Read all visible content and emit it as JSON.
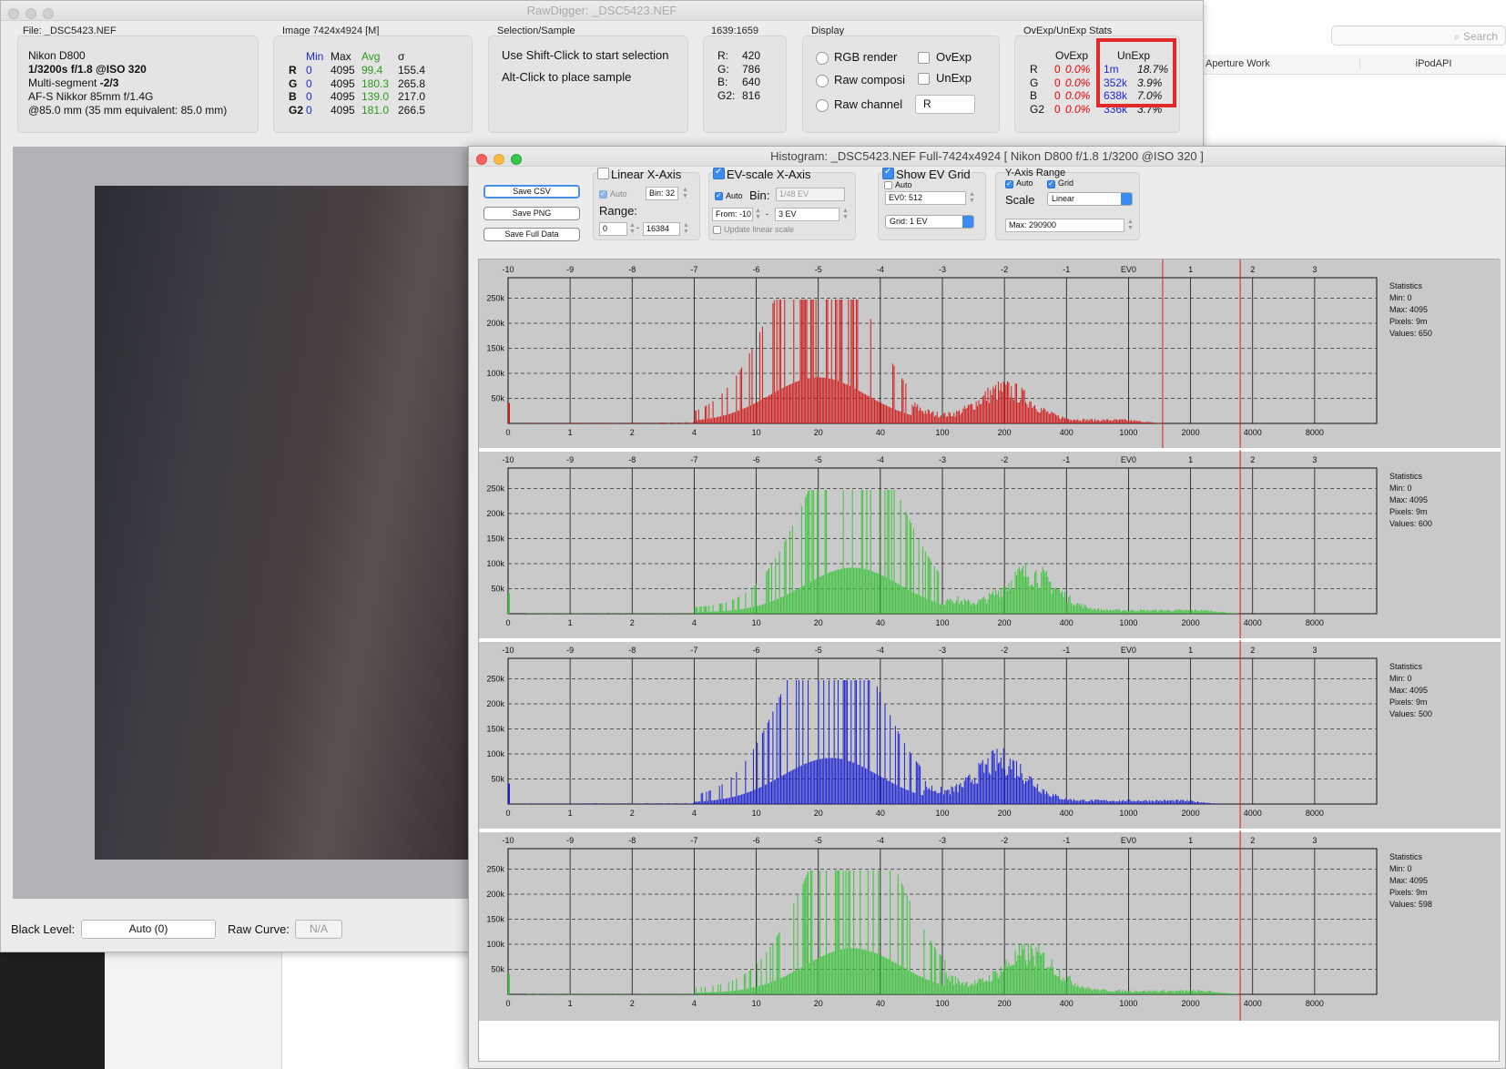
{
  "main_window": {
    "title": "RawDigger: _DSC5423.NEF",
    "file": {
      "title": "File: _DSC5423.NEF",
      "camera": "Nikon D800",
      "exposure": "1/3200s f/1.8 @ISO 320",
      "metering_prefix": "Multi-segment ",
      "metering_value": "-2/3",
      "lens": "AF-S Nikkor 85mm f/1.4G",
      "focal": "@85.0 mm (35 mm equivalent: 85.0 mm)"
    },
    "image": {
      "title": "Image 7424x4924 [M]",
      "headers": [
        "Min",
        "Max",
        "Avg",
        "σ"
      ],
      "rows": [
        {
          "ch": "R",
          "min": "0",
          "max": "4095",
          "avg": "99.4",
          "sigma": "155.4"
        },
        {
          "ch": "G",
          "min": "0",
          "max": "4095",
          "avg": "180.3",
          "sigma": "265.8"
        },
        {
          "ch": "B",
          "min": "0",
          "max": "4095",
          "avg": "139.0",
          "sigma": "217.0"
        },
        {
          "ch": "G2",
          "min": "0",
          "max": "4095",
          "avg": "181.0",
          "sigma": "266.5"
        }
      ]
    },
    "selection": {
      "title": "Selection/Sample",
      "line1": "Use Shift-Click to start selection",
      "line2": "Alt-Click to place sample"
    },
    "sample": {
      "title": "1639:1659",
      "rows": [
        {
          "k": "R:",
          "v": "420"
        },
        {
          "k": "G:",
          "v": "786"
        },
        {
          "k": "B:",
          "v": "640"
        },
        {
          "k": "G2:",
          "v": "816"
        }
      ]
    },
    "display": {
      "title": "Display",
      "rgb": "RGB render",
      "raw_comp": "Raw composi",
      "raw_channel": "Raw channel",
      "ovexp": "OvExp",
      "unexp": "UnExp",
      "channel_value": "R"
    },
    "stats": {
      "title": "OvExp/UnExp Stats",
      "ov_header": "OvExp",
      "un_header": "UnExp",
      "rows": [
        {
          "ch": "R",
          "ov": "0",
          "ovp": "0.0%",
          "un": "1m",
          "unp": "18.7%"
        },
        {
          "ch": "G",
          "ov": "0",
          "ovp": "0.0%",
          "un": "352k",
          "unp": "3.9%"
        },
        {
          "ch": "B",
          "ov": "0",
          "ovp": "0.0%",
          "un": "638k",
          "unp": "7.0%"
        },
        {
          "ch": "G2",
          "ov": "0",
          "ovp": "0.0%",
          "un": "336k",
          "unp": "3.7%"
        }
      ]
    },
    "black_level_label": "Black Level:",
    "black_level_value": "Auto (0)",
    "raw_curve_label": "Raw Curve:",
    "raw_curve_value": "N/A"
  },
  "background": {
    "search_placeholder": "Search",
    "col1": "Aperture Work",
    "col2": "iPodAPI"
  },
  "histogram_window": {
    "title": "Histogram: _DSC5423.NEF Full-7424x4924 [ Nikon D800 f/1.8 1/3200 @ISO 320 ]",
    "buttons": [
      "Save CSV",
      "Save PNG",
      "Save Full Data"
    ],
    "linear": {
      "label": "Linear X-Axis",
      "auto": "Auto",
      "bin": "Bin: 32",
      "range_label": "Range:",
      "range_from": "0",
      "range_to": "16384"
    },
    "ev": {
      "label": "EV-scale X-Axis",
      "auto": "Auto",
      "bin_label": "Bin:",
      "bin": "1/48 EV",
      "from": "From: -10",
      "to": "3 EV",
      "update": "Update linear scale"
    },
    "evgrid": {
      "label": "Show EV Grid",
      "auto": "Auto",
      "ev0": "EV0: 512",
      "grid": "Grid: 1 EV"
    },
    "yaxis": {
      "label": "Y-Axis Range",
      "auto": "Auto",
      "grid": "Grid",
      "scale_label": "Scale",
      "scale": "Linear",
      "max": "Max: 290900"
    },
    "ev_ticks": [
      "-10",
      "-9",
      "-8",
      "-7",
      "-6",
      "-5",
      "-4",
      "-3",
      "-2",
      "-1",
      "EV0",
      "1",
      "2",
      "3"
    ],
    "x_ticks": [
      "0",
      "1",
      "2",
      "4",
      "10",
      "20",
      "40",
      "100",
      "200",
      "400",
      "1000",
      "2000",
      "4000",
      "8000"
    ],
    "y_ticks": [
      "250k",
      "200k",
      "150k",
      "100k",
      "50k"
    ],
    "stats_title": "Statistics",
    "plots": [
      {
        "channel": "R",
        "color": "#d11a1a",
        "min": "Min: 0",
        "max": "Max: 4095",
        "pixels": "Pixels: 9m",
        "values": "Values: 650",
        "peak_ev": -5.0,
        "hump_ev": -2.0,
        "hump": 0.27,
        "end_ev": 0.55,
        "sel_ev": 0.55
      },
      {
        "channel": "G",
        "color": "#3cc43c",
        "min": "Min: 0",
        "max": "Max: 4095",
        "pixels": "Pixels: 9m",
        "values": "Values: 600",
        "peak_ev": -4.45,
        "hump_ev": -1.6,
        "hump": 0.33,
        "end_ev": 1.8,
        "sel_ev": 1.8
      },
      {
        "channel": "B",
        "color": "#1c22d2",
        "min": "Min: 0",
        "max": "Max: 4095",
        "pixels": "Pixels: 9m",
        "values": "Values: 500",
        "peak_ev": -4.8,
        "hump_ev": -2.05,
        "hump": 0.35,
        "end_ev": 1.5,
        "sel_ev": 1.8
      },
      {
        "channel": "G2",
        "color": "#3cc43c",
        "min": "Min: 0",
        "max": "Max: 4095",
        "pixels": "Pixels: 9m",
        "values": "Values: 598",
        "peak_ev": -4.45,
        "hump_ev": -1.6,
        "hump": 0.33,
        "end_ev": 1.8,
        "sel_ev": 1.8
      }
    ]
  }
}
